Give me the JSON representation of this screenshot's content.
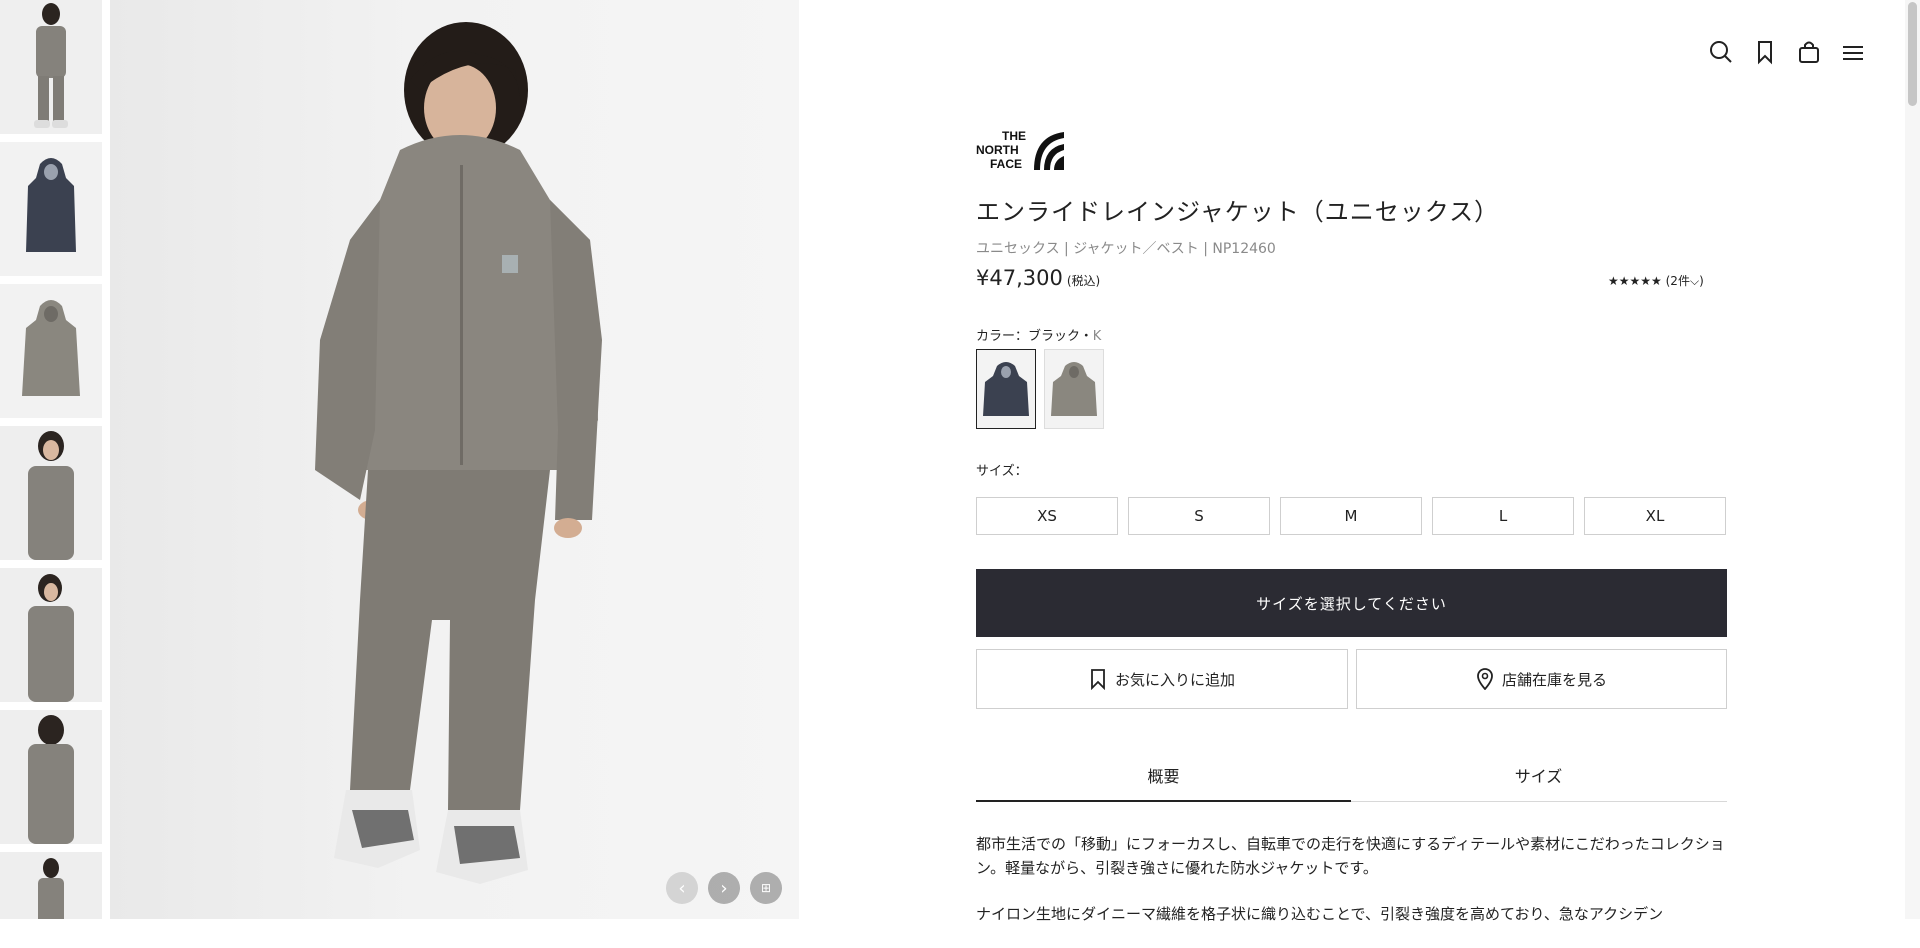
{
  "brand": {
    "logo_line1": "THE",
    "logo_line2": "NORTH",
    "logo_line3": "FACE"
  },
  "header": {
    "icons": [
      "search-icon",
      "bookmark-icon",
      "shopping-bag-icon",
      "menu-icon"
    ]
  },
  "gallery": {
    "thumbnails": [
      {
        "name": "thumb-model-front",
        "variant": "grey-model"
      },
      {
        "name": "thumb-jacket-black",
        "variant": "black-jacket"
      },
      {
        "name": "thumb-jacket-grey",
        "variant": "grey-jacket"
      },
      {
        "name": "thumb-model-closeup",
        "variant": "grey-model"
      },
      {
        "name": "thumb-model-side",
        "variant": "grey-model"
      },
      {
        "name": "thumb-model-back",
        "variant": "grey-model"
      },
      {
        "name": "thumb-model-partial",
        "variant": "grey-model"
      }
    ],
    "controls": [
      "prev-arrow-icon",
      "next-arrow-icon",
      "grid-icon"
    ]
  },
  "product": {
    "title": "エンライドレインジャケット（ユニセックス）",
    "meta": "ユニセックス | ジャケット／ベスト | NP12460",
    "price": "¥47,300",
    "tax_note": "(税込)",
    "rating_stars": "★★★★★",
    "rating_count": "(2件",
    "rating_chevron": "⌵",
    "color_label": "カラー：ブラック・",
    "color_code": "K",
    "colors": [
      {
        "name": "black",
        "hex": "#3b4150",
        "selected": true
      },
      {
        "name": "grey",
        "hex": "#8a877f",
        "selected": false
      }
    ],
    "size_label": "サイズ：",
    "sizes": [
      "XS",
      "S",
      "M",
      "L",
      "XL"
    ],
    "cta_label": "サイズを選択してください",
    "favorite_label": "お気に入りに追加",
    "store_label": "店舗在庫を見る",
    "tabs": [
      "概要",
      "サイズ"
    ],
    "active_tab": 0,
    "description": [
      "都市生活での「移動」にフォーカスし、自転車での走行を快適にするディテールや素材にこだわったコレクション。軽量ながら、引裂き強さに優れた防水ジャケットです。",
      "ナイロン生地にダイニーマ繊維を格子状に織り込むことで、引裂き強度を高めており、急なアクシデン"
    ]
  },
  "colors": {
    "cta_bg": "#2b2b33",
    "border": "#cfcfcf",
    "muted_text": "#8a8a8a"
  }
}
